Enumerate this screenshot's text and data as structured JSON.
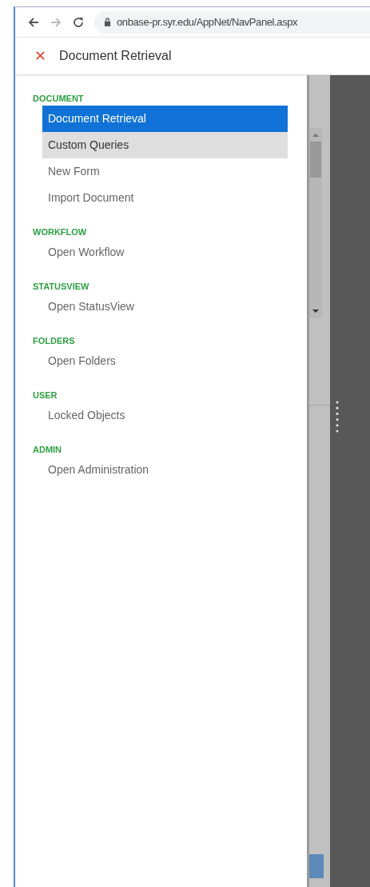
{
  "browser": {
    "url": "onbase-pr.syr.edu/AppNet/NavPanel.aspx"
  },
  "header": {
    "close": "✕",
    "title": "Document Retrieval"
  },
  "sections": [
    {
      "title": "DOCUMENT",
      "items": [
        {
          "label": "Document Retrieval",
          "selected": true,
          "hovered": false
        },
        {
          "label": "Custom Queries",
          "selected": false,
          "hovered": true
        },
        {
          "label": "New Form",
          "selected": false,
          "hovered": false
        },
        {
          "label": "Import Document",
          "selected": false,
          "hovered": false
        }
      ]
    },
    {
      "title": "WORKFLOW",
      "items": [
        {
          "label": "Open Workflow",
          "selected": false,
          "hovered": false
        }
      ]
    },
    {
      "title": "STATUSVIEW",
      "items": [
        {
          "label": "Open StatusView",
          "selected": false,
          "hovered": false
        }
      ]
    },
    {
      "title": "FOLDERS",
      "items": [
        {
          "label": "Open Folders",
          "selected": false,
          "hovered": false
        }
      ]
    },
    {
      "title": "USER",
      "items": [
        {
          "label": "Locked Objects",
          "selected": false,
          "hovered": false
        }
      ]
    },
    {
      "title": "ADMIN",
      "items": [
        {
          "label": "Open Administration",
          "selected": false,
          "hovered": false
        }
      ]
    }
  ]
}
